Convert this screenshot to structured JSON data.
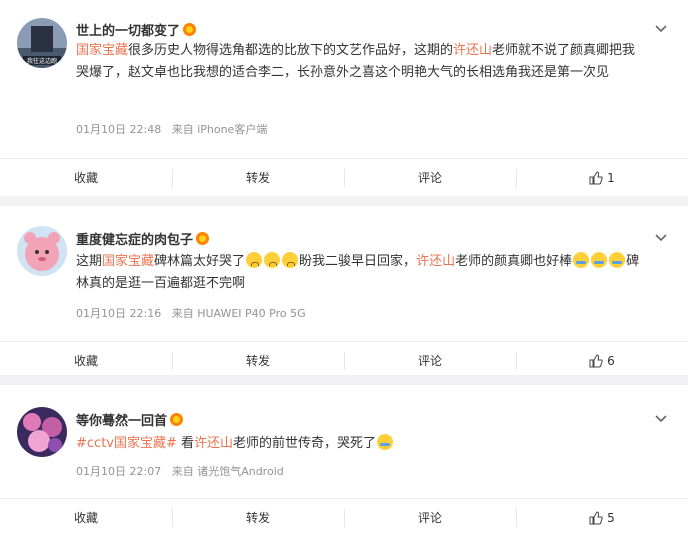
{
  "comments": [
    {
      "user": "世上的一切都变了",
      "avatar_caption": "我往这边跑",
      "segments": [
        {
          "t": "国家宝藏",
          "hl": true
        },
        {
          "t": "很多历史人物得选角都选的比放下的文艺作品好，这期的"
        },
        {
          "t": "许还山",
          "hl": true
        },
        {
          "t": "老师就不说了颜真卿把我哭爆了，赵文卓也比我想的适合李二，长孙意外之喜这个明艳大气的长相选角我还是第一次见"
        }
      ],
      "time": "01月10日 22:48",
      "source": "来自 iPhone客户端",
      "actions": {
        "collect": "收藏",
        "repost": "转发",
        "comment": "评论",
        "likes": "1"
      }
    },
    {
      "user": "重度健忘症的肉包子",
      "segments": [
        {
          "t": "这期"
        },
        {
          "t": "国家宝藏",
          "hl": true
        },
        {
          "t": "碑林篇太好哭了"
        },
        {
          "emoji": "sad"
        },
        {
          "emoji": "sad"
        },
        {
          "emoji": "sad"
        },
        {
          "t": "盼我二骏早日回家，"
        },
        {
          "t": "许还山",
          "hl": true
        },
        {
          "t": "老师的颜真卿也好棒"
        },
        {
          "emoji": "cry"
        },
        {
          "emoji": "cry"
        },
        {
          "emoji": "cry"
        },
        {
          "t": "碑林真的是逛一百遍都逛不完啊"
        }
      ],
      "time": "01月10日 22:16",
      "source": "来自 HUAWEI P40 Pro 5G",
      "actions": {
        "collect": "收藏",
        "repost": "转发",
        "comment": "评论",
        "likes": "6"
      }
    },
    {
      "user": "等你蓦然一回首",
      "segments": [
        {
          "t": "#cctv国家宝藏#",
          "hl": true
        },
        {
          "t": " 看"
        },
        {
          "t": "许还山",
          "hl": true
        },
        {
          "t": "老师的前世传奇，哭死了"
        },
        {
          "emoji": "cry"
        }
      ],
      "time": "01月10日 22:07",
      "source": "来自 诸光饱气Android",
      "actions": {
        "collect": "收藏",
        "repost": "转发",
        "comment": "评论",
        "likes": "5"
      }
    }
  ]
}
